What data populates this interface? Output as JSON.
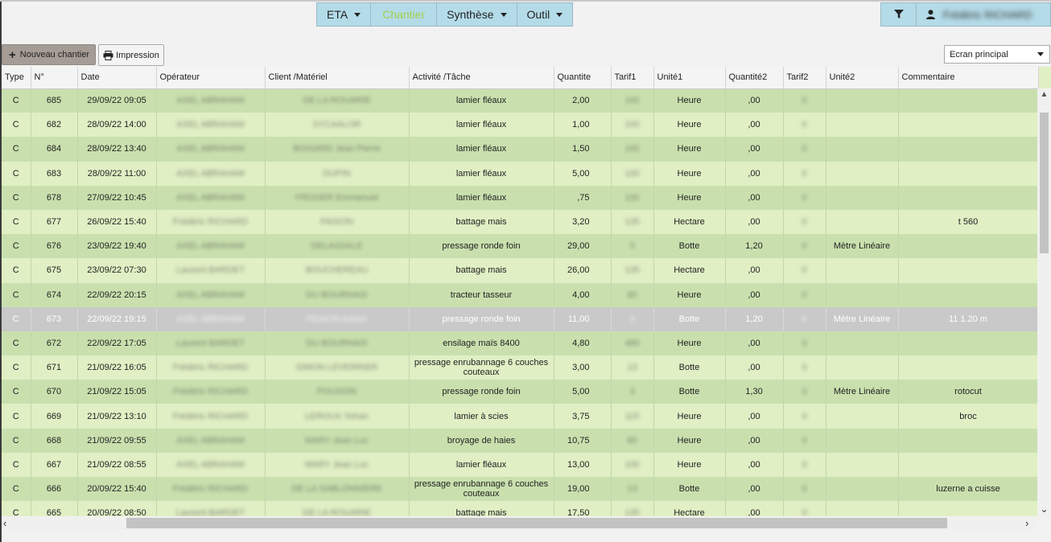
{
  "nav": {
    "items": [
      {
        "label": "ETA",
        "dropdown": true,
        "active": false
      },
      {
        "label": "Chantier",
        "dropdown": false,
        "active": true
      },
      {
        "label": "Synthèse",
        "dropdown": true,
        "active": false
      },
      {
        "label": "Outil",
        "dropdown": true,
        "active": false
      }
    ],
    "user_name": "Frédéric RICHARD",
    "filter_icon": "filter-icon",
    "user_icon": "user-icon"
  },
  "toolbar": {
    "new_label": "Nouveau chantier",
    "print_label": "Impression",
    "screen_select": "Ecran principal"
  },
  "colors": {
    "nav_bg": "#b4dbe8",
    "nav_active": "#9ed24a",
    "row_odd": "#c9e0ae",
    "row_even": "#e0efc4",
    "row_selected": "#c9c9c9",
    "btn_new_bg": "#a59c96"
  },
  "table": {
    "columns": [
      "Type",
      "N°",
      "Date",
      "Opérateur",
      "Client /Matériel",
      "Activité /Tâche",
      "Quantite",
      "Tarif1",
      "Unité1",
      "Quantité2",
      "Tarif2",
      "Unité2",
      "Commentaire"
    ],
    "selected_index": 9,
    "rows": [
      [
        "C",
        "685",
        "29/09/22 09:05",
        "AXEL ABRAHAM",
        "DE LA ROUARIE",
        "lamier fléaux",
        "2,00",
        "100",
        "Heure",
        ",00",
        "0",
        "",
        ""
      ],
      [
        "C",
        "682",
        "28/09/22 14:00",
        "AXEL ABRAHAM",
        "SYCAALOR",
        "lamier fléaux",
        "1,00",
        "100",
        "Heure",
        ",00",
        "0",
        "",
        ""
      ],
      [
        "C",
        "684",
        "28/09/22 13:40",
        "AXEL ABRAHAM",
        "BOISARD Jean Pierre",
        "lamier fléaux",
        "1,50",
        "100",
        "Heure",
        ",00",
        "0",
        "",
        ""
      ],
      [
        "C",
        "683",
        "28/09/22 11:00",
        "AXEL ABRAHAM",
        "DUPIN",
        "lamier fléaux",
        "5,00",
        "100",
        "Heure",
        ",00",
        "0",
        "",
        ""
      ],
      [
        "C",
        "678",
        "27/09/22 10:45",
        "AXEL ABRAHAM",
        "FROGER Emmanuel",
        "lamier fléaux",
        ",75",
        "100",
        "Heure",
        ",00",
        "0",
        "",
        ""
      ],
      [
        "C",
        "677",
        "26/09/22 15:40",
        "Frédéric RICHARD",
        "PAISON",
        "battage mais",
        "3,20",
        "135",
        "Hectare",
        ",00",
        "0",
        "",
        "t 560"
      ],
      [
        "C",
        "676",
        "23/09/22 19:40",
        "AXEL ABRAHAM",
        "DELASSALE",
        "pressage ronde foin",
        "29,00",
        "3",
        "Botte",
        "1,20",
        "0",
        "Mètre Linéaire",
        ""
      ],
      [
        "C",
        "675",
        "23/09/22 07:30",
        "Laurent BARDET",
        "BOUCHEREAU",
        "battage mais",
        "26,00",
        "135",
        "Hectare",
        ",00",
        "0",
        "",
        ""
      ],
      [
        "C",
        "674",
        "22/09/22 20:15",
        "AXEL ABRAHAM",
        "DU BOURNAIS",
        "tracteur tasseur",
        "4,00",
        "80",
        "Heure",
        ",00",
        "0",
        "",
        ""
      ],
      [
        "C",
        "673",
        "22/09/22 19:15",
        "AXEL ABRAHAM",
        "PEAION Adrien",
        "pressage ronde foin",
        "11,00",
        "3",
        "Botte",
        "1,20",
        "0",
        "Mètre Linéaire",
        "11 1.20 m"
      ],
      [
        "C",
        "672",
        "22/09/22 17:05",
        "Laurent BARDET",
        "DU BOURNAIS",
        "ensilage maïs 8400",
        "4,80",
        "480",
        "Heure",
        ",00",
        "0",
        "",
        ""
      ],
      [
        "C",
        "671",
        "21/09/22 16:05",
        "Frédéric RICHARD",
        "SIMON LEVERRIER",
        "pressage enrubannage 6 couches couteaux",
        "3,00",
        "13",
        "Botte",
        ",00",
        "0",
        "",
        ""
      ],
      [
        "C",
        "670",
        "21/09/22 15:05",
        "Frédéric RICHARD",
        "POUSSIN",
        "pressage ronde foin",
        "5,00",
        "3",
        "Botte",
        "1,30",
        "0",
        "Mètre Linéaire",
        "rotocut"
      ],
      [
        "C",
        "669",
        "21/09/22 13:10",
        "Frédéric RICHARD",
        "LEROUX Yohan",
        "lamier à scies",
        "3,75",
        "115",
        "Heure",
        ",00",
        "0",
        "",
        "broc"
      ],
      [
        "C",
        "668",
        "21/09/22 09:55",
        "AXEL ABRAHAM",
        "MARY Jean Luc",
        "broyage de haies",
        "10,75",
        "80",
        "Heure",
        ",00",
        "0",
        "",
        ""
      ],
      [
        "C",
        "667",
        "21/09/22 08:55",
        "AXEL ABRAHAM",
        "MARY Jean Luc",
        "lamier fléaux",
        "13,00",
        "100",
        "Heure",
        ",00",
        "0",
        "",
        ""
      ],
      [
        "C",
        "666",
        "20/09/22 15:40",
        "Frédéric RICHARD",
        "DE LA SABLONNIERE",
        "pressage enrubannage 6 couches couteaux",
        "19,00",
        "13",
        "Botte",
        ",00",
        "0",
        "",
        "luzerne a cuisse"
      ],
      [
        "C",
        "665",
        "20/09/22 08:50",
        "Laurent BARDET",
        "DE LA ROUARIE",
        "battage mais",
        "17,50",
        "135",
        "Hectare",
        ",00",
        "0",
        "",
        ""
      ]
    ]
  }
}
